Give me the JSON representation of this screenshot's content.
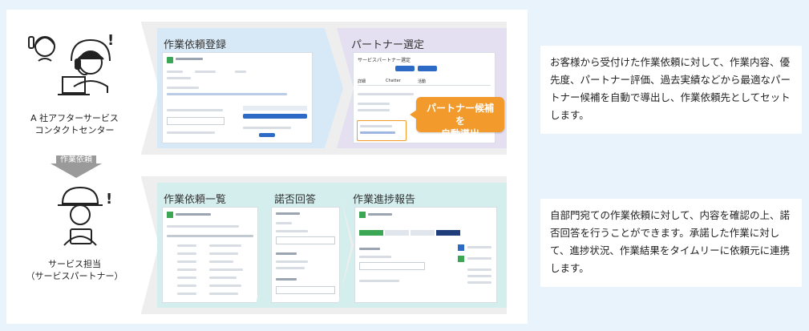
{
  "personas": {
    "contact_center": "A 社アフターサービス\nコンタクトセンター",
    "service_partner": "サービス担当\n（サービスパートナー）"
  },
  "handoff_label": "作業依頼",
  "row1": {
    "steps": [
      {
        "title": "作業依頼登録",
        "color": "#d7e8f6"
      },
      {
        "title": "パートナー選定",
        "color": "#e4dff1"
      }
    ],
    "callout": "パートナー候補を\n自動導出",
    "mini": {
      "partner_header": "サービスパートナー選定",
      "tab_detail": "詳細",
      "tab_chatter": "Chatter",
      "tab_activity": "活動"
    }
  },
  "row2": {
    "steps": [
      {
        "title": "作業依頼一覧",
        "color": "#d4eeee"
      },
      {
        "title": "諾否回答",
        "color": "#d4eeee"
      },
      {
        "title": "作業進捗報告",
        "color": "#d4eeee"
      }
    ]
  },
  "descriptions": {
    "top": "お客様から受付けた作業依頼に対して、作業内容、優先度、パートナー評価、過去実績などから最適なパートナー候補を自動で導出し、作業依頼先としてセットします。",
    "bottom": "自部門宛ての作業依頼に対して、内容を確認の上、諾否回答を行うことができます。承諾した作業に対して、進捗状況、作業結果をタイムリーに依頼元に連携します。"
  },
  "colors": {
    "accent_orange": "#f39a2c",
    "salesforce_blue": "#2c6ac6"
  },
  "icons": [
    "operator-headset-icon",
    "worker-helmet-icon",
    "down-arrow-icon"
  ]
}
